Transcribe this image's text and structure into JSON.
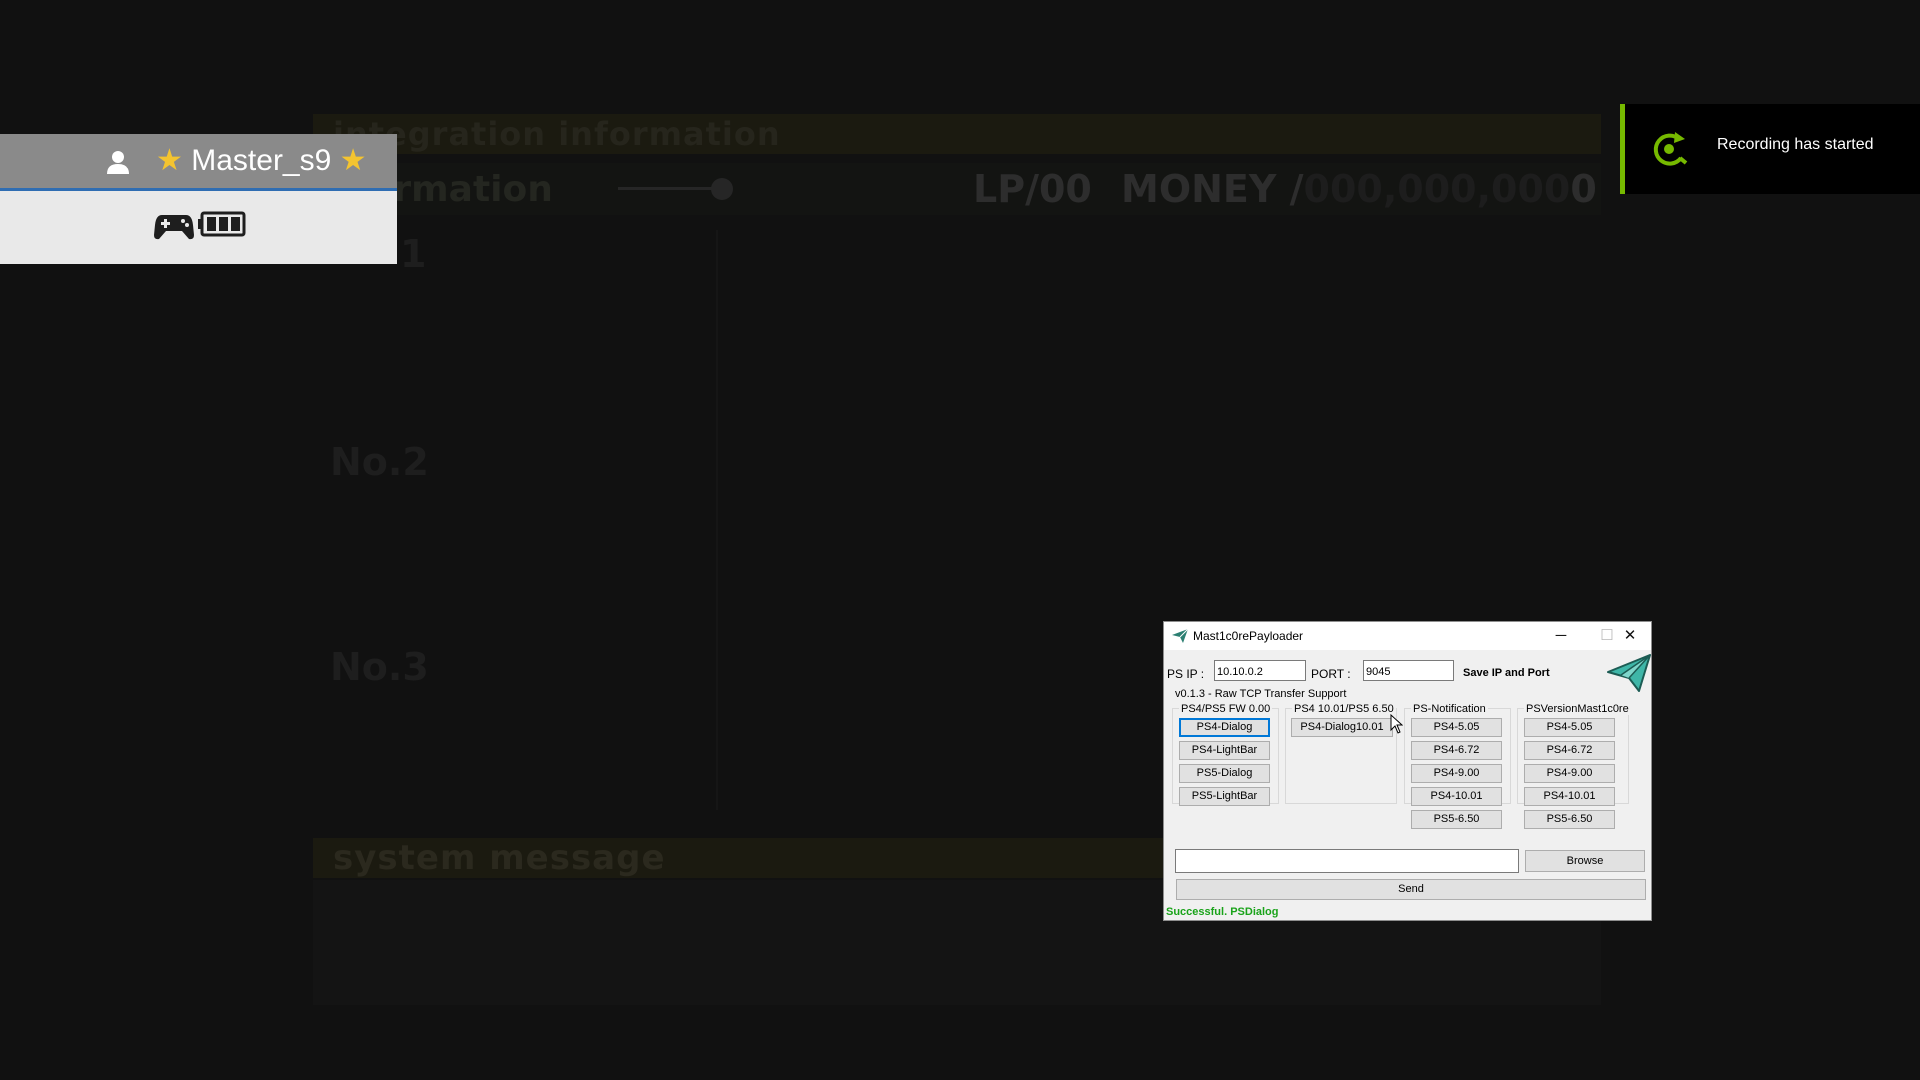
{
  "game": {
    "banner_top": "integration information",
    "info_label": "formation",
    "lp": "LP/00",
    "money_label": "MONEY /",
    "money_value_dim": "000,000,000",
    "money_value_last": "0",
    "slot1": "1",
    "slot2": "No.2",
    "slot3": "No.3",
    "banner_sys": "system message"
  },
  "user_panel": {
    "star_left": "★",
    "username": "Master_s9",
    "star_right": "★",
    "icons": [
      "user-icon",
      "gamepad-icon",
      "battery-icon"
    ]
  },
  "toast": {
    "text": "Recording has started",
    "icon": "record-icon",
    "accent_color": "#76b900"
  },
  "app": {
    "title": "Mast1c0rePayloader",
    "min_glyph": "─",
    "max_glyph": "☐",
    "close_glyph": "✕",
    "ip_label": "PS IP  :",
    "ip_value": "10.10.0.2",
    "port_label": "PORT  :",
    "port_value": "9045",
    "save_label": "Save IP and Port",
    "version": "v0.1.3 - Raw TCP Transfer Support",
    "groups": [
      {
        "title": "PS4/PS5 FW 0.00",
        "buttons": [
          "PS4-Dialog",
          "PS4-LightBar",
          "PS5-Dialog",
          "PS5-LightBar"
        ]
      },
      {
        "title": "PS4 10.01/PS5 6.50",
        "buttons": [
          "PS4-Dialog10.01"
        ]
      },
      {
        "title": "PS-Notification",
        "buttons": [
          "PS4-5.05",
          "PS4-6.72",
          "PS4-9.00",
          "PS4-10.01",
          "PS5-6.50"
        ]
      },
      {
        "title": "PSVersionMast1c0re",
        "buttons": [
          "PS4-5.05",
          "PS4-6.72",
          "PS4-9.00",
          "PS4-10.01",
          "PS5-6.50"
        ]
      }
    ],
    "file_path": "",
    "browse_label": "Browse",
    "send_label": "Send",
    "status": "Successful. PSDialog",
    "status_color": "#1aa31a"
  }
}
